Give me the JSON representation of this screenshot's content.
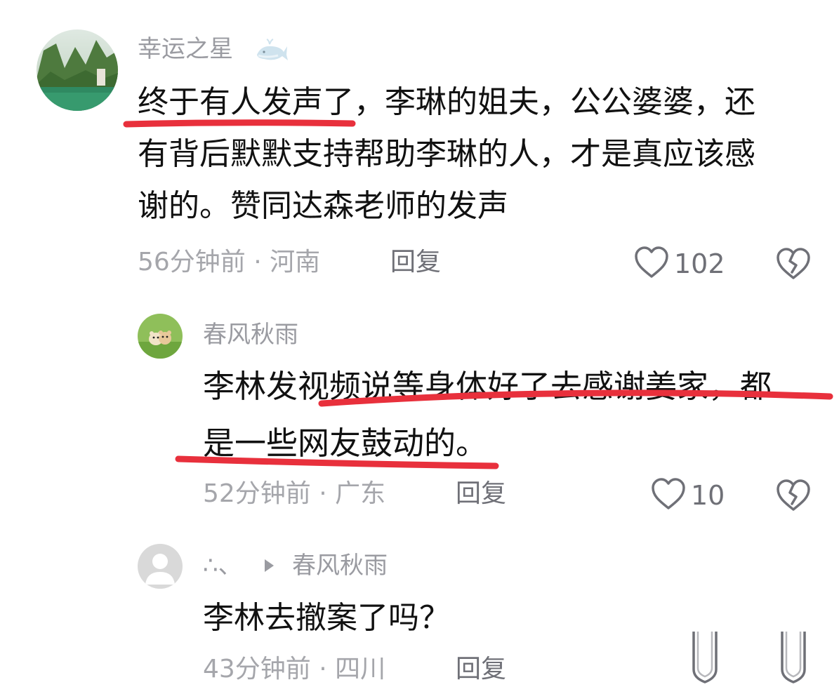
{
  "comments": [
    {
      "username": "幸运之星",
      "badge_icon": "whale-icon",
      "text_lines": [
        "终于有人发声了，李琳的姐夫，公公婆婆，还",
        "有背后默默支持帮助李琳的人，才是真应该感",
        "谢的。赞同达森老师的发声"
      ],
      "meta": "56分钟前 · 河南",
      "reply_label": "回复",
      "like_count": "102"
    },
    {
      "username": "春风秋雨",
      "text_lines": [
        "李林发视频说等身体好了去感谢姜家，都",
        "是一些网友鼓动的。"
      ],
      "meta": "52分钟前 · 广东",
      "reply_label": "回复",
      "like_count": "10"
    },
    {
      "username": "∴、",
      "reply_to": "春风秋雨",
      "text_lines": [
        "李林去撤案了吗？"
      ],
      "meta": "43分钟前 · 四川",
      "reply_label": "回复"
    }
  ],
  "colors": {
    "underline": "#e8303c",
    "username": "#9a9ba1",
    "meta": "#a5a6ab",
    "body_text": "#111111"
  }
}
